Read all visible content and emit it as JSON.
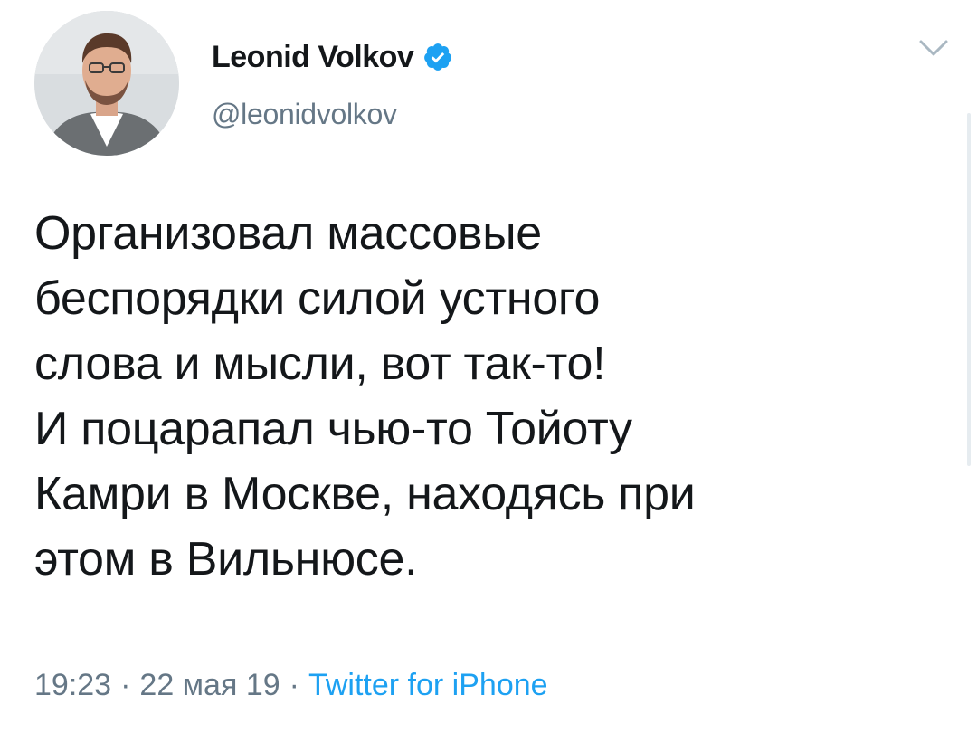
{
  "user": {
    "display_name": "Leonid Volkov",
    "handle": "@leonidvolkov",
    "verified": true,
    "avatar_icon": "avatar-photo"
  },
  "tweet": {
    "lines": [
      "Организовал массовые",
      "беспорядки силой устного",
      "слова и мысли, вот так-то!",
      "И поцарапал чью-то Тойоту",
      "Камри в Москве, находясь при",
      "этом в Вильнюсе."
    ]
  },
  "meta": {
    "time": "19:23",
    "separator": "·",
    "date": "22 мая 19",
    "source": "Twitter for iPhone"
  },
  "colors": {
    "accent": "#1da1f2",
    "text": "#14171a",
    "muted": "#657786"
  },
  "icons": {
    "verified": "verified-badge-icon",
    "menu": "chevron-down-icon"
  }
}
